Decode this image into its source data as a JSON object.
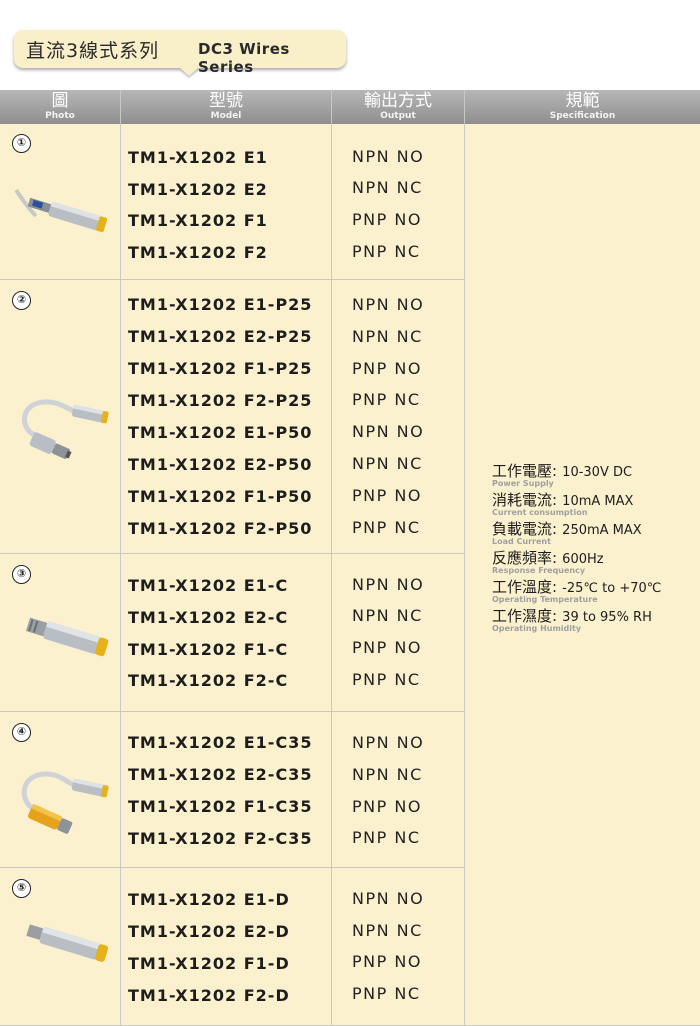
{
  "title": {
    "zh": "直流3線式系列",
    "en": "DC3 Wires Series"
  },
  "headers": {
    "photo": {
      "zh": "圖",
      "en": "Photo"
    },
    "model": {
      "zh": "型號",
      "en": "Model"
    },
    "output": {
      "zh": "輸出方式",
      "en": "Output"
    },
    "spec": {
      "zh": "規範",
      "en": "Specification"
    }
  },
  "groups": [
    {
      "number": "①",
      "rows": [
        {
          "model": "TM1-X1202 E1",
          "output": "NPN NO"
        },
        {
          "model": "TM1-X1202 E2",
          "output": "NPN NC"
        },
        {
          "model": "TM1-X1202 F1",
          "output": "PNP NO"
        },
        {
          "model": "TM1-X1202 F2",
          "output": "PNP NC"
        }
      ]
    },
    {
      "number": "②",
      "rows": [
        {
          "model": "TM1-X1202 E1-P25",
          "output": "NPN NO"
        },
        {
          "model": "TM1-X1202 E2-P25",
          "output": "NPN NC"
        },
        {
          "model": "TM1-X1202 F1-P25",
          "output": "PNP NO"
        },
        {
          "model": "TM1-X1202 F2-P25",
          "output": "PNP NC"
        },
        {
          "model": "TM1-X1202 E1-P50",
          "output": "NPN NO"
        },
        {
          "model": "TM1-X1202 E2-P50",
          "output": "NPN NC"
        },
        {
          "model": "TM1-X1202 F1-P50",
          "output": "PNP NO"
        },
        {
          "model": "TM1-X1202 F2-P50",
          "output": "PNP NC"
        }
      ]
    },
    {
      "number": "③",
      "rows": [
        {
          "model": "TM1-X1202 E1-C",
          "output": "NPN NO"
        },
        {
          "model": "TM1-X1202 E2-C",
          "output": "NPN NC"
        },
        {
          "model": "TM1-X1202 F1-C",
          "output": "PNP NO"
        },
        {
          "model": "TM1-X1202 F2-C",
          "output": "PNP NC"
        }
      ]
    },
    {
      "number": "④",
      "rows": [
        {
          "model": "TM1-X1202 E1-C35",
          "output": "NPN NO"
        },
        {
          "model": "TM1-X1202 E2-C35",
          "output": "NPN NC"
        },
        {
          "model": "TM1-X1202 F1-C35",
          "output": "PNP NO"
        },
        {
          "model": "TM1-X1202 F2-C35",
          "output": "PNP NC"
        }
      ]
    },
    {
      "number": "⑤",
      "rows": [
        {
          "model": "TM1-X1202 E1-D",
          "output": "NPN NO"
        },
        {
          "model": "TM1-X1202 E2-D",
          "output": "NPN NC"
        },
        {
          "model": "TM1-X1202 F1-D",
          "output": "PNP NO"
        },
        {
          "model": "TM1-X1202 F2-D",
          "output": "PNP NC"
        }
      ]
    }
  ],
  "specs": [
    {
      "label": "工作電壓",
      "en": "Power Supply",
      "value": "10-30V DC"
    },
    {
      "label": "消耗電流",
      "en": "Current consumption",
      "value": "10mA MAX"
    },
    {
      "label": "負載電流",
      "en": "Load Current",
      "value": "250mA MAX"
    },
    {
      "label": "反應頻率",
      "en": "Response Frequency",
      "value": "600Hz"
    },
    {
      "label": "工作溫度",
      "en": "Operating Temperature",
      "value": "-25℃ to +70℃"
    },
    {
      "label": "工作濕度",
      "en": "Operating Humidity",
      "value": "39 to 95% RH"
    }
  ],
  "colors": {
    "cell_bg": "#fbf1ce",
    "header_bg": "#9e9e9e",
    "title_bg": "#f9efc9",
    "sensor_cap": "#e6b21c"
  }
}
